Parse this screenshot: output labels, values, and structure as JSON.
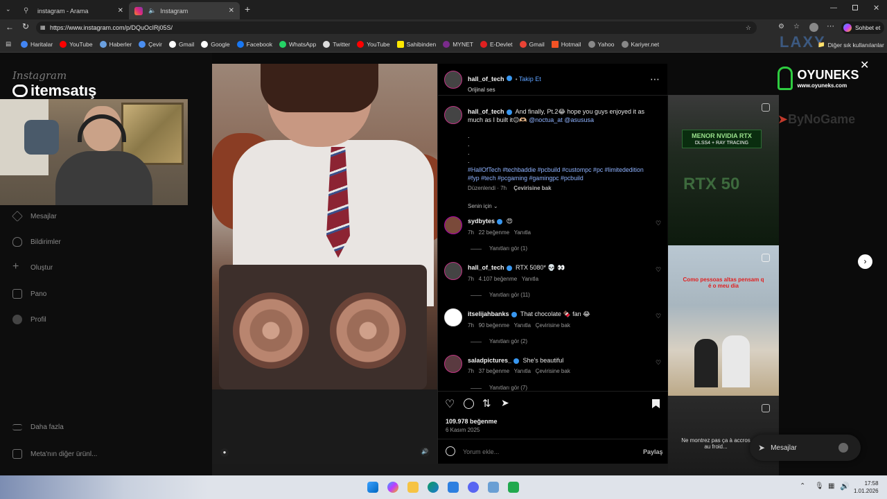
{
  "browser": {
    "tabs": [
      {
        "title": "instagram - Arama"
      },
      {
        "title": "Instagram"
      }
    ],
    "url": "https://www.instagram.com/p/DQuOcIRj05S/",
    "chat_button": "Sohbet et",
    "bookmarks": [
      "Haritalar",
      "YouTube",
      "Haberler",
      "Çevir",
      "Gmail",
      "Google",
      "Facebook",
      "WhatsApp",
      "Twitter",
      "YouTube",
      "Sahibinden",
      "MYNET",
      "E-Devlet",
      "Gmail",
      "Hotmail",
      "Yahoo",
      "Kariyer.net"
    ],
    "other_bookmarks": "Diğer sık kullanılanlar"
  },
  "overlay": {
    "instagram_logo": "Instagram",
    "sponsor_left": "itemsatış",
    "sponsor_right": "OYUNEKS",
    "sponsor_right_url": "www.oyuneks.com",
    "sponsor_right2": "ByNoGame",
    "laxy": "LAXY"
  },
  "leftnav": {
    "items": [
      "Mesajlar",
      "Bildirimler",
      "Oluştur",
      "Pano",
      "Profil"
    ],
    "more": "Daha fazla",
    "meta": "Meta'nın diğer ürünl..."
  },
  "post": {
    "author": "hall_of_tech",
    "follow": "Takip Et",
    "audio": "Orijinal ses",
    "caption_text": "And finally, Pt.2😂 hope you guys enjoyed it as much as I built it😉🫶🏼",
    "mentions": "@noctua_at @asususa",
    "dots": ".",
    "hashtags1": "#HallOfTech #techbaddie #pcbuild #custompc #pc #limitededition",
    "hashtags2": "#fyp #tech #pcgaming #gamingpc #pcbuild",
    "edited": "Düzenlendi · 7h",
    "see_translation": "Çevirisine bak",
    "sort": "Senin için",
    "likes": "109.978 beğenme",
    "date": "6 Kasım 2025",
    "comment_placeholder": "Yorum ekle...",
    "share": "Paylaş"
  },
  "comments": [
    {
      "user": "sydbytes",
      "text": "😍",
      "time": "7h",
      "likes": "22 beğenme",
      "reply": "Yanıtla",
      "translate": "",
      "view_replies": "Yanıtları gör (1)"
    },
    {
      "user": "hall_of_tech",
      "text": "RTX 5080* 💀 👀",
      "time": "7h",
      "likes": "4.107 beğenme",
      "reply": "Yanıtla",
      "translate": "",
      "view_replies": "Yanıtları gör (11)"
    },
    {
      "user": "itselijahbanks",
      "text": "That chocolate 🍫 fan 😂",
      "time": "7h",
      "likes": "90 beğenme",
      "reply": "Yanıtla",
      "translate": "Çevirisine bak",
      "view_replies": "Yanıtları gör (2)"
    },
    {
      "user": "saladpictures_",
      "text": "She's beautiful",
      "time": "7h",
      "likes": "37 beğenme",
      "reply": "Yanıtla",
      "translate": "Çevirisine bak",
      "view_replies": "Yanıtları gör (7)"
    }
  ],
  "thumbs": {
    "t1_line1": "MENOR NVIDIA RTX",
    "t1_line2": "DLSS4 + RAY TRACING",
    "t1_line3": "RTX 50",
    "t2_text": "Como pessoas altas pensam q é o meu dia",
    "t3_text": "Ne montrez pas ça à accros au froid..."
  },
  "messages_widget": "Mesajlar",
  "taskbar": {
    "time": "17:58",
    "date": "1.01.2026"
  },
  "colors": {
    "link": "#8fb3ff",
    "verified": "#3897f0",
    "bg": "#000000"
  }
}
